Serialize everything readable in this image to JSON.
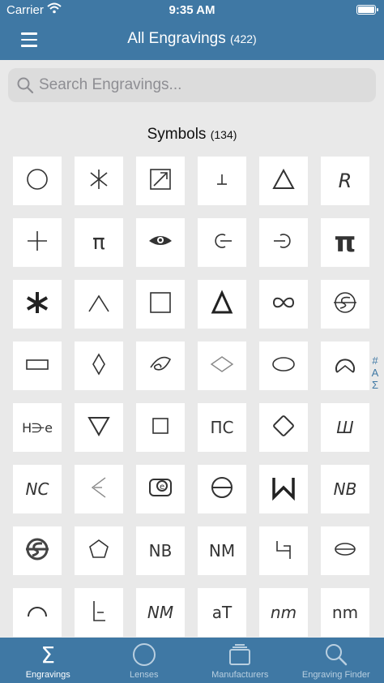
{
  "status_bar": {
    "carrier": "Carrier",
    "time": "9:35 AM"
  },
  "nav": {
    "title": "All Engravings",
    "count": "(422)"
  },
  "search": {
    "placeholder": "Search Engravings..."
  },
  "section": {
    "title": "Symbols",
    "count": "(134)"
  },
  "symbols": [
    "circle",
    "asterisk-burst",
    "square-arrow",
    "up-tack",
    "triangle-outline",
    "r-letter",
    "plus",
    "pi-thin",
    "eye",
    "c-line",
    "c-line-reverse",
    "pi-bold",
    "asterisk-bold",
    "caret-up",
    "square",
    "triangle-bold",
    "infinity",
    "s-circle",
    "rectangle",
    "diamond-tall",
    "scroll-e",
    "diamond-thin",
    "ellipse",
    "omega-arch",
    "h-e",
    "triangle-down",
    "small-square",
    "pi-c",
    "diamond-rounded",
    "sha-italic",
    "nc-italic",
    "star-triangle",
    "e-box",
    "circle-bar",
    "w-bold",
    "nb-italic",
    "s-circle-bold",
    "pentagon",
    "nb",
    "nm",
    "4-shape",
    "ellipse-bar",
    "arc",
    "l-corner",
    "nm-italic",
    "at",
    "nm-script",
    "nm-round"
  ],
  "symbol_texts": {
    "r-letter": "R",
    "pi-thin": "π",
    "pi-bold": "π",
    "nb": "NB",
    "nm": "NM",
    "nb-italic": "NB",
    "nm-italic": "NM",
    "nm-script": "nm",
    "nm-round": "nm",
    "at": "aT",
    "nc-italic": "NC",
    "pi-c": "ΠC",
    "sha-italic": "Ш",
    "h-e": "H⋺e"
  },
  "index": [
    "#",
    "A",
    "Σ"
  ],
  "tabs": [
    {
      "label": "Engravings",
      "icon": "sigma-icon",
      "active": true
    },
    {
      "label": "Lenses",
      "icon": "lens-circle-icon",
      "active": false
    },
    {
      "label": "Manufacturers",
      "icon": "folder-stack-icon",
      "active": false
    },
    {
      "label": "Engraving Finder",
      "icon": "search-icon",
      "active": false
    }
  ],
  "colors": {
    "accent": "#3f78a4",
    "background": "#e9e9e9",
    "tile": "#ffffff"
  }
}
